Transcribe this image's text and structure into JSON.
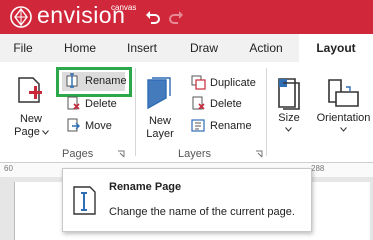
{
  "app": {
    "brand": "envision",
    "brand_sub": "canvas"
  },
  "tabs": [
    "File",
    "Home",
    "Insert",
    "Draw",
    "Action",
    "Layout"
  ],
  "active_tab": "Layout",
  "ribbon": {
    "new_page": [
      "New",
      "Page"
    ],
    "rename": "Rename",
    "delete": "Delete",
    "move": "Move",
    "pages_group": "Pages",
    "new_layer": [
      "New",
      "Layer"
    ],
    "duplicate": "Duplicate",
    "delete_layer": "Delete",
    "rename_layer": "Rename",
    "layers_group": "Layers",
    "size": "Size",
    "orientation": "Orientation"
  },
  "ruler": {
    "left": "60",
    "right": "288"
  },
  "tooltip": {
    "title": "Rename Page",
    "description": "Change the name of the current page."
  },
  "colors": {
    "brand": "#d0283a",
    "highlight": "#2aa84a",
    "accent_red": "#c8283a",
    "accent_blue": "#2f6db5"
  }
}
